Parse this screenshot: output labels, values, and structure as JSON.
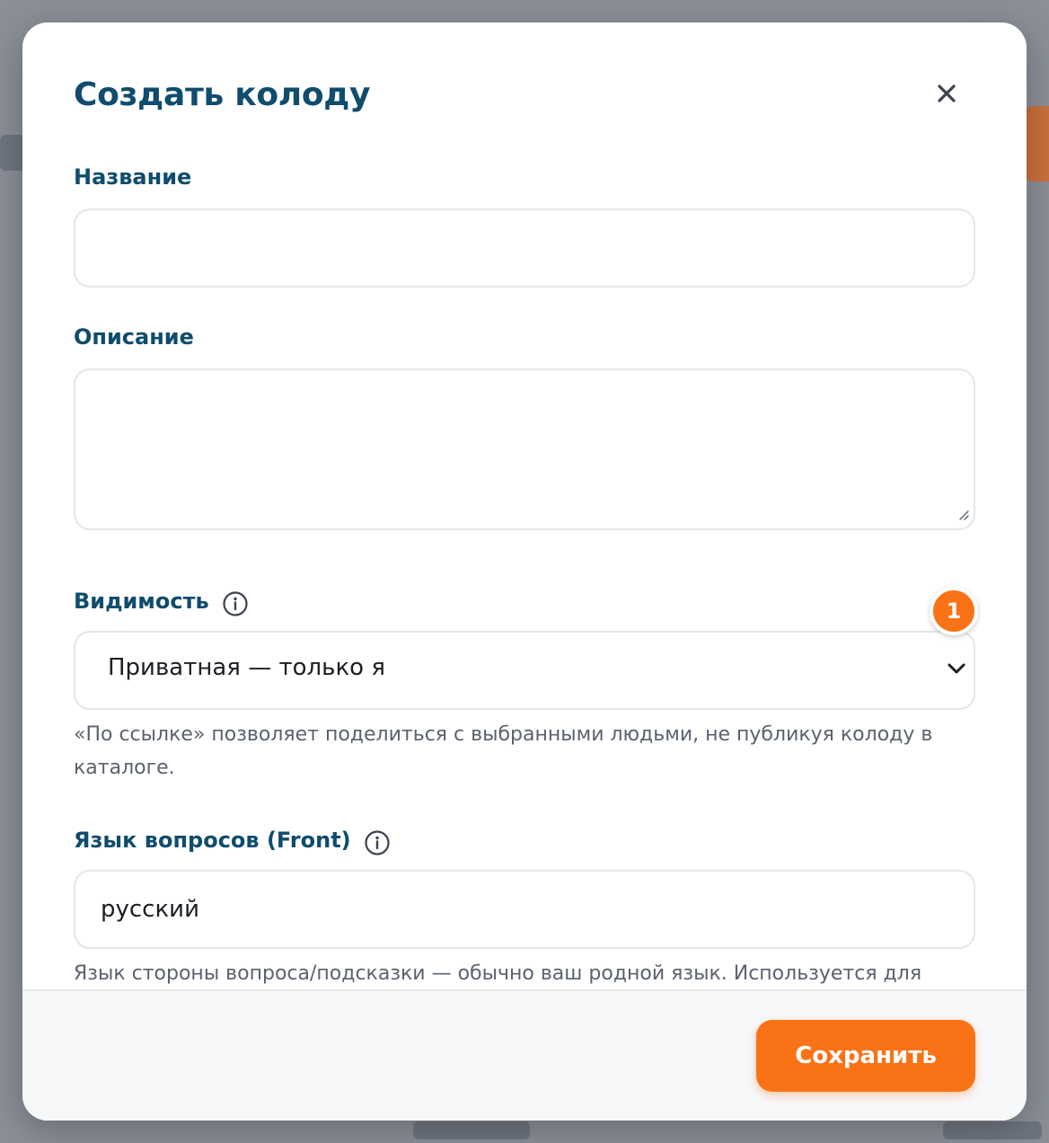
{
  "modal": {
    "title": "Создать колоду",
    "close_icon": "close-icon"
  },
  "form": {
    "name": {
      "label": "Название",
      "value": "",
      "placeholder": ""
    },
    "description": {
      "label": "Описание",
      "value": "",
      "placeholder": ""
    },
    "visibility": {
      "label": "Видимость",
      "info_icon": "info-icon",
      "selected": "Приватная — только я",
      "help": "«По ссылке» позволяет поделиться с выбранными людьми, не публикуя колоду в каталоге.",
      "badge": "1"
    },
    "front_language": {
      "label": "Язык вопросов (Front)",
      "info_icon": "info-icon",
      "value": "русский",
      "help": "Язык стороны вопроса/подсказки — обычно ваш родной язык. Используется для"
    }
  },
  "footer": {
    "save_label": "Сохранить"
  },
  "colors": {
    "accent": "#f97316",
    "heading": "#0f4c6e"
  }
}
